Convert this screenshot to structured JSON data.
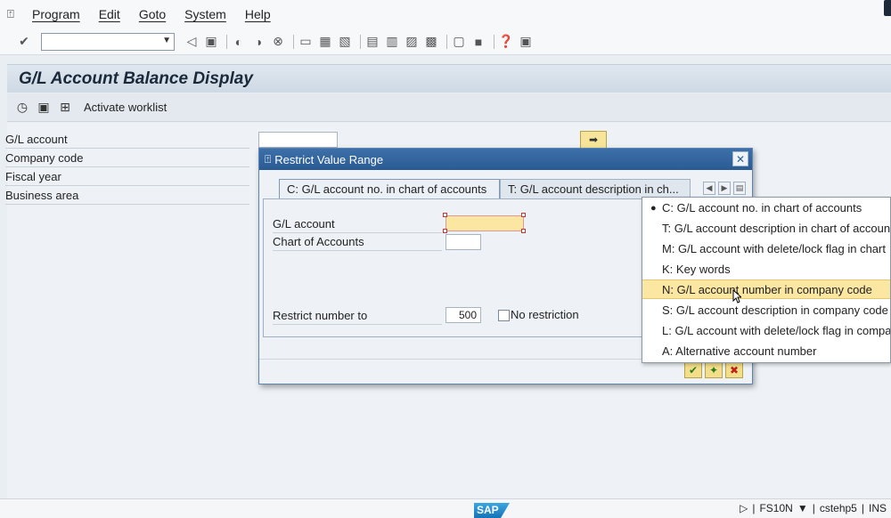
{
  "menu": {
    "items": [
      "Program",
      "Edit",
      "Goto",
      "System",
      "Help"
    ]
  },
  "window": {
    "title": "G/L Account Balance Display"
  },
  "appbar": {
    "worklist_label": "Activate worklist"
  },
  "form": {
    "fields": [
      "G/L account",
      "Company code",
      "Fiscal year",
      "Business area"
    ]
  },
  "dialog": {
    "title": "Restrict Value Range",
    "tabs": [
      "C: G/L account no. in chart of accounts",
      "T: G/L account description in ch..."
    ],
    "fields": {
      "gl_account": "G/L account",
      "chart_of_accounts": "Chart of Accounts",
      "restrict_label": "Restrict number to"
    },
    "restrict_value": "500",
    "no_restriction_label": "No restriction"
  },
  "dropdown": {
    "items": [
      "C: G/L account no. in chart of accounts",
      "T: G/L account description in chart of accounts",
      "M: G/L account with delete/lock flag in chart",
      "K: Key words",
      "N: G/L account number in company code",
      "S: G/L account description in company code",
      "L: G/L account with delete/lock flag in company code",
      "A: Alternative account number"
    ],
    "selected_index": 4,
    "bullet_index": 0
  },
  "status": {
    "logo": "SAP",
    "transaction": "FS10N",
    "server": "cstehp5",
    "mode": "INS"
  },
  "colors": {
    "title_blue": "#2a5b95",
    "highlight": "#fbe6a2"
  }
}
